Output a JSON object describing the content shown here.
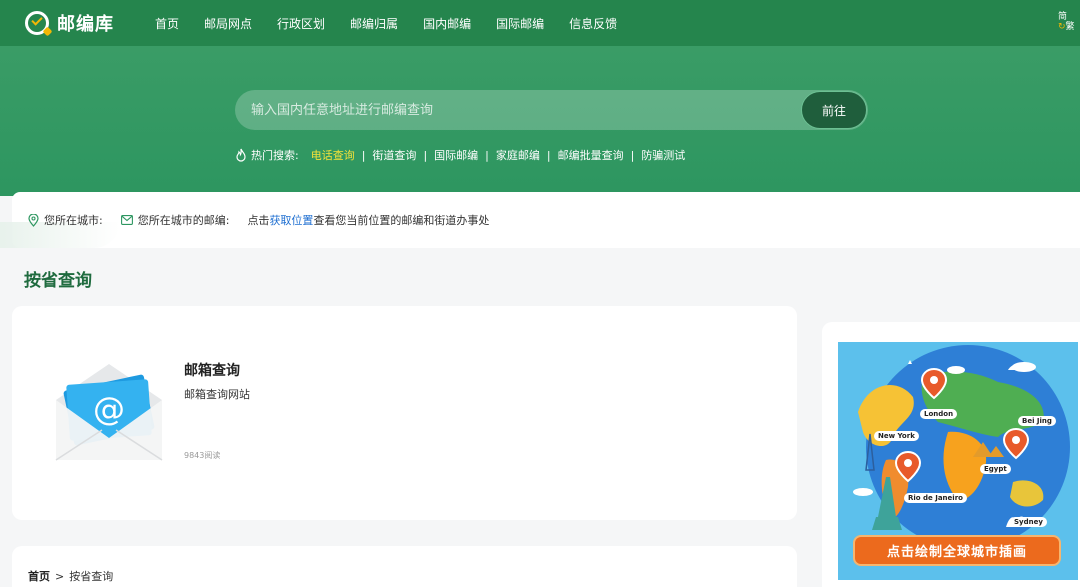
{
  "header": {
    "logo_text": "邮编库",
    "nav": [
      "首页",
      "邮局网点",
      "行政区划",
      "邮编归属",
      "国内邮编",
      "国际邮编",
      "信息反馈"
    ],
    "lang_simplified": "简",
    "lang_traditional": "繁"
  },
  "search": {
    "placeholder": "输入国内任意地址进行邮编查询",
    "button_label": "前往"
  },
  "hot_search": {
    "label": "热门搜索:",
    "items": [
      "电话查询",
      "街道查询",
      "国际邮编",
      "家庭邮编",
      "邮编批量查询",
      "防骗测试"
    ]
  },
  "location_bar": {
    "city_label": "您所在城市:",
    "zip_label": "您所在城市的邮编:",
    "prompt_prefix": "点击",
    "prompt_link": "获取位置",
    "prompt_suffix": "查看您当前位置的邮编和街道办事处"
  },
  "section": {
    "title": "按省查询"
  },
  "card": {
    "title": "邮箱查询",
    "description": "邮箱查询网站",
    "reads": "9843阅读"
  },
  "breadcrumb": {
    "home": "首页",
    "separator": ">",
    "current": "按省查询"
  },
  "ad": {
    "button_label": "点击绘制全球城市插画",
    "cities": [
      "London",
      "Bei Jing",
      "New York",
      "Egypt",
      "Rio de Janeiro",
      "Sydney"
    ]
  },
  "colors": {
    "header_green": "#25854d",
    "hero_green": "#3a9c66",
    "highlight_yellow": "#f3e23a",
    "link_blue": "#1f6fd1",
    "title_green": "#1f6b3f",
    "ad_orange": "#ec6a1d"
  }
}
